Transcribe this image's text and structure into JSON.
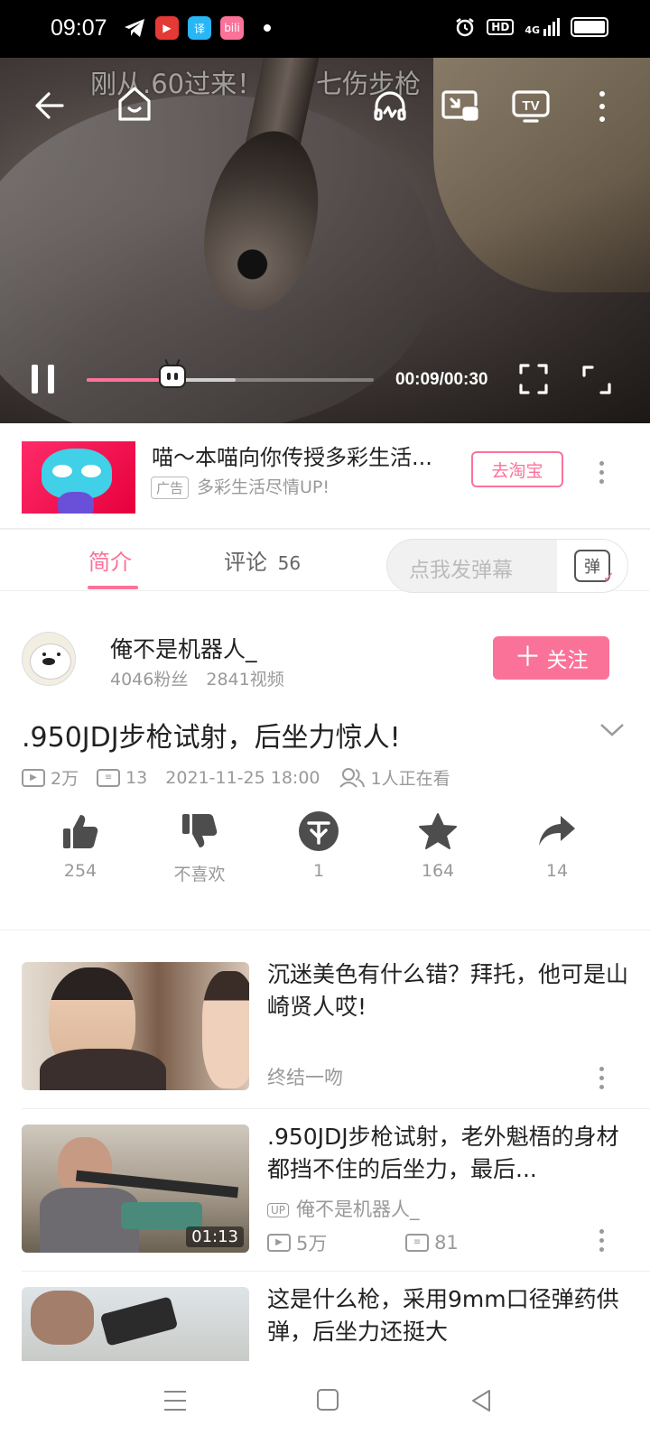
{
  "status_bar": {
    "time": "09:07",
    "notification_icons": [
      "telegram-icon",
      "youtube-icon",
      "translate-app-icon",
      "bilibili-icon"
    ],
    "right_icons": [
      "alarm-icon",
      "hd-icon",
      "signal-4g-icon",
      "battery-icon"
    ],
    "hd_label": "HD",
    "network": "4G"
  },
  "player": {
    "danmaku": [
      "刚从.60过来！",
      "七伤步枪"
    ],
    "time_display": "00:09/00:30",
    "progress_fraction": 0.3,
    "buffered_fraction": 0.52
  },
  "ad": {
    "title": "喵～本喵向你传授多彩生活...",
    "tag": "广告",
    "subtitle": "多彩生活尽情UP!",
    "cta": "去淘宝"
  },
  "tabs": {
    "intro": "简介",
    "comments": "评论",
    "comments_count": "56",
    "danmaku_placeholder": "点我发弹幕",
    "danmaku_toggle": "弹"
  },
  "uploader": {
    "name": "俺不是机器人_",
    "fans": "4046粉丝",
    "videos": "2841视频",
    "follow": "关注"
  },
  "video": {
    "title": ".950JDJ步枪试射，后坐力惊人!",
    "views": "2万",
    "danmaku_count": "13",
    "date": "2021-11-25 18:00",
    "watching": "1人正在看"
  },
  "actions": {
    "like": "254",
    "dislike": "不喜欢",
    "coin": "1",
    "favorite": "164",
    "share": "14"
  },
  "related": [
    {
      "title": "沉迷美色有什么错？拜托，他可是山崎贤人哎!",
      "subtitle": "终结一吻"
    },
    {
      "title": ".950JDJ步枪试射，老外魁梧的身材都挡不住的后坐力，最后...",
      "up_badge": "UP",
      "uploader": "俺不是机器人_",
      "views": "5万",
      "danmaku": "81",
      "duration": "01:13"
    },
    {
      "title": "这是什么枪，采用9mm口径弹药供弹，后坐力还挺大"
    }
  ],
  "colors": {
    "accent": "#fb7299",
    "text_secondary": "#999999"
  }
}
